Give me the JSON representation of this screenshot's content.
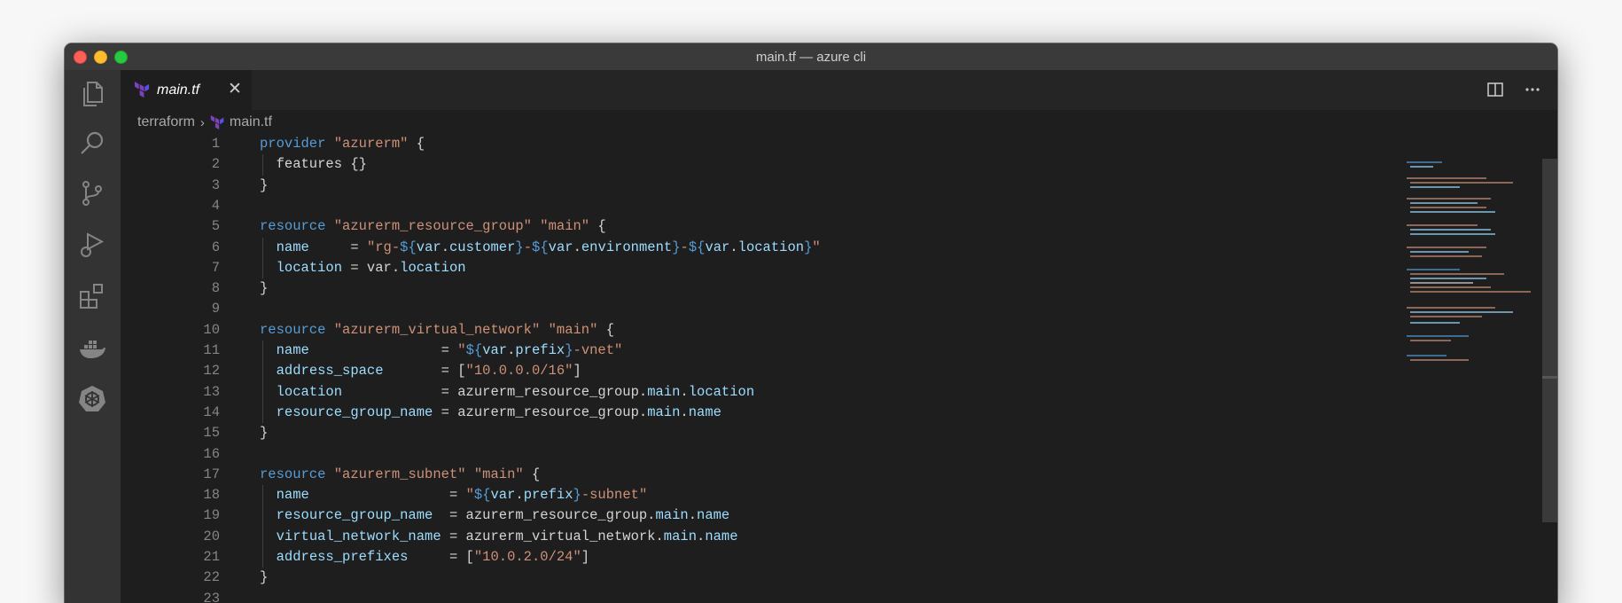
{
  "window": {
    "title": "main.tf — azure cli"
  },
  "activity_bar": {
    "items": [
      "explorer-icon",
      "search-icon",
      "source-control-icon",
      "run-debug-icon",
      "extensions-icon",
      "docker-icon",
      "kubernetes-icon"
    ]
  },
  "tab": {
    "label": "main.tf",
    "close": "✕"
  },
  "breadcrumb": {
    "folder": "terraform",
    "separator": "›",
    "file": "main.tf"
  },
  "colors": {
    "keyword": "#569cd6",
    "string": "#ce9178",
    "attribute": "#9cdcfe",
    "text": "#d4d4d4",
    "line_number": "#858585",
    "terraform_logo": "#7b42bc"
  },
  "code_lines": [
    {
      "n": "1",
      "tokens": [
        [
          "kw",
          "provider"
        ],
        [
          "plain",
          " "
        ],
        [
          "str",
          "\"azurerm\""
        ],
        [
          "plain",
          " {"
        ]
      ]
    },
    {
      "n": "2",
      "tokens": [
        [
          "plain",
          "  features {}"
        ]
      ]
    },
    {
      "n": "3",
      "tokens": [
        [
          "plain",
          "}"
        ]
      ]
    },
    {
      "n": "4",
      "tokens": []
    },
    {
      "n": "5",
      "tokens": [
        [
          "kw",
          "resource"
        ],
        [
          "plain",
          " "
        ],
        [
          "str",
          "\"azurerm_resource_group\""
        ],
        [
          "plain",
          " "
        ],
        [
          "str",
          "\"main\""
        ],
        [
          "plain",
          " {"
        ]
      ]
    },
    {
      "n": "6",
      "tokens": [
        [
          "plain",
          "  "
        ],
        [
          "attr",
          "name"
        ],
        [
          "plain",
          "     = "
        ],
        [
          "str",
          "\"rg-"
        ],
        [
          "interp",
          "${"
        ],
        [
          "attr",
          "var"
        ],
        [
          "plain",
          "."
        ],
        [
          "prop",
          "customer"
        ],
        [
          "interp",
          "}"
        ],
        [
          "str",
          "-"
        ],
        [
          "interp",
          "${"
        ],
        [
          "attr",
          "var"
        ],
        [
          "plain",
          "."
        ],
        [
          "prop",
          "environment"
        ],
        [
          "interp",
          "}"
        ],
        [
          "str",
          "-"
        ],
        [
          "interp",
          "${"
        ],
        [
          "attr",
          "var"
        ],
        [
          "plain",
          "."
        ],
        [
          "prop",
          "location"
        ],
        [
          "interp",
          "}"
        ],
        [
          "str",
          "\""
        ]
      ]
    },
    {
      "n": "7",
      "tokens": [
        [
          "plain",
          "  "
        ],
        [
          "attr",
          "location"
        ],
        [
          "plain",
          " = var."
        ],
        [
          "prop",
          "location"
        ]
      ]
    },
    {
      "n": "8",
      "tokens": [
        [
          "plain",
          "}"
        ]
      ]
    },
    {
      "n": "9",
      "tokens": []
    },
    {
      "n": "10",
      "tokens": [
        [
          "kw",
          "resource"
        ],
        [
          "plain",
          " "
        ],
        [
          "str",
          "\"azurerm_virtual_network\""
        ],
        [
          "plain",
          " "
        ],
        [
          "str",
          "\"main\""
        ],
        [
          "plain",
          " {"
        ]
      ]
    },
    {
      "n": "11",
      "tokens": [
        [
          "plain",
          "  "
        ],
        [
          "attr",
          "name"
        ],
        [
          "plain",
          "                = "
        ],
        [
          "str",
          "\""
        ],
        [
          "interp",
          "${"
        ],
        [
          "attr",
          "var"
        ],
        [
          "plain",
          "."
        ],
        [
          "prop",
          "prefix"
        ],
        [
          "interp",
          "}"
        ],
        [
          "str",
          "-vnet\""
        ]
      ]
    },
    {
      "n": "12",
      "tokens": [
        [
          "plain",
          "  "
        ],
        [
          "attr",
          "address_space"
        ],
        [
          "plain",
          "       = ["
        ],
        [
          "str",
          "\"10.0.0.0/16\""
        ],
        [
          "plain",
          "]"
        ]
      ]
    },
    {
      "n": "13",
      "tokens": [
        [
          "plain",
          "  "
        ],
        [
          "attr",
          "location"
        ],
        [
          "plain",
          "            = azurerm_resource_group."
        ],
        [
          "prop",
          "main"
        ],
        [
          "plain",
          "."
        ],
        [
          "prop",
          "location"
        ]
      ]
    },
    {
      "n": "14",
      "tokens": [
        [
          "plain",
          "  "
        ],
        [
          "attr",
          "resource_group_name"
        ],
        [
          "plain",
          " = azurerm_resource_group."
        ],
        [
          "prop",
          "main"
        ],
        [
          "plain",
          "."
        ],
        [
          "prop",
          "name"
        ]
      ]
    },
    {
      "n": "15",
      "tokens": [
        [
          "plain",
          "}"
        ]
      ]
    },
    {
      "n": "16",
      "tokens": []
    },
    {
      "n": "17",
      "tokens": [
        [
          "kw",
          "resource"
        ],
        [
          "plain",
          " "
        ],
        [
          "str",
          "\"azurerm_subnet\""
        ],
        [
          "plain",
          " "
        ],
        [
          "str",
          "\"main\""
        ],
        [
          "plain",
          " {"
        ]
      ]
    },
    {
      "n": "18",
      "tokens": [
        [
          "plain",
          "  "
        ],
        [
          "attr",
          "name"
        ],
        [
          "plain",
          "                 = "
        ],
        [
          "str",
          "\""
        ],
        [
          "interp",
          "${"
        ],
        [
          "attr",
          "var"
        ],
        [
          "plain",
          "."
        ],
        [
          "prop",
          "prefix"
        ],
        [
          "interp",
          "}"
        ],
        [
          "str",
          "-subnet\""
        ]
      ]
    },
    {
      "n": "19",
      "tokens": [
        [
          "plain",
          "  "
        ],
        [
          "attr",
          "resource_group_name"
        ],
        [
          "plain",
          "  = azurerm_resource_group."
        ],
        [
          "prop",
          "main"
        ],
        [
          "plain",
          "."
        ],
        [
          "prop",
          "name"
        ]
      ]
    },
    {
      "n": "20",
      "tokens": [
        [
          "plain",
          "  "
        ],
        [
          "attr",
          "virtual_network_name"
        ],
        [
          "plain",
          " = azurerm_virtual_network."
        ],
        [
          "prop",
          "main"
        ],
        [
          "plain",
          "."
        ],
        [
          "prop",
          "name"
        ]
      ]
    },
    {
      "n": "21",
      "tokens": [
        [
          "plain",
          "  "
        ],
        [
          "attr",
          "address_prefixes"
        ],
        [
          "plain",
          "     = ["
        ],
        [
          "str",
          "\"10.0.2.0/24\""
        ],
        [
          "plain",
          "]"
        ]
      ]
    },
    {
      "n": "22",
      "tokens": [
        [
          "plain",
          "}"
        ]
      ]
    },
    {
      "n": "23",
      "tokens": []
    }
  ]
}
